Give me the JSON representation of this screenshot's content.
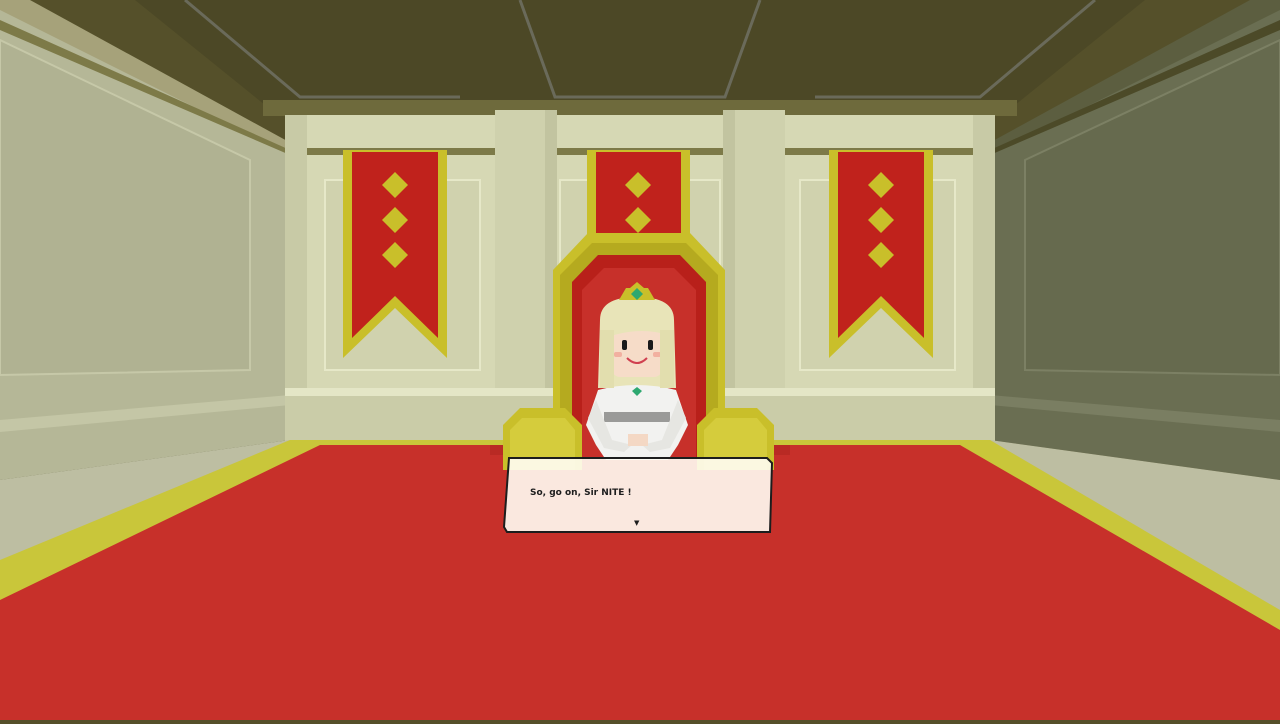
{
  "dialog": {
    "text": "So, go on, Sir NITE !",
    "advance_glyph": "▼"
  },
  "colors": {
    "ceiling": "#55502a",
    "wall": "#d6d8b4",
    "banner_red": "#c0221c",
    "banner_gold": "#c9bf2a",
    "carpet": "#c7302a",
    "princess_white": "#f2f2f0"
  },
  "icons": {
    "advance": "down-triangle-icon"
  }
}
